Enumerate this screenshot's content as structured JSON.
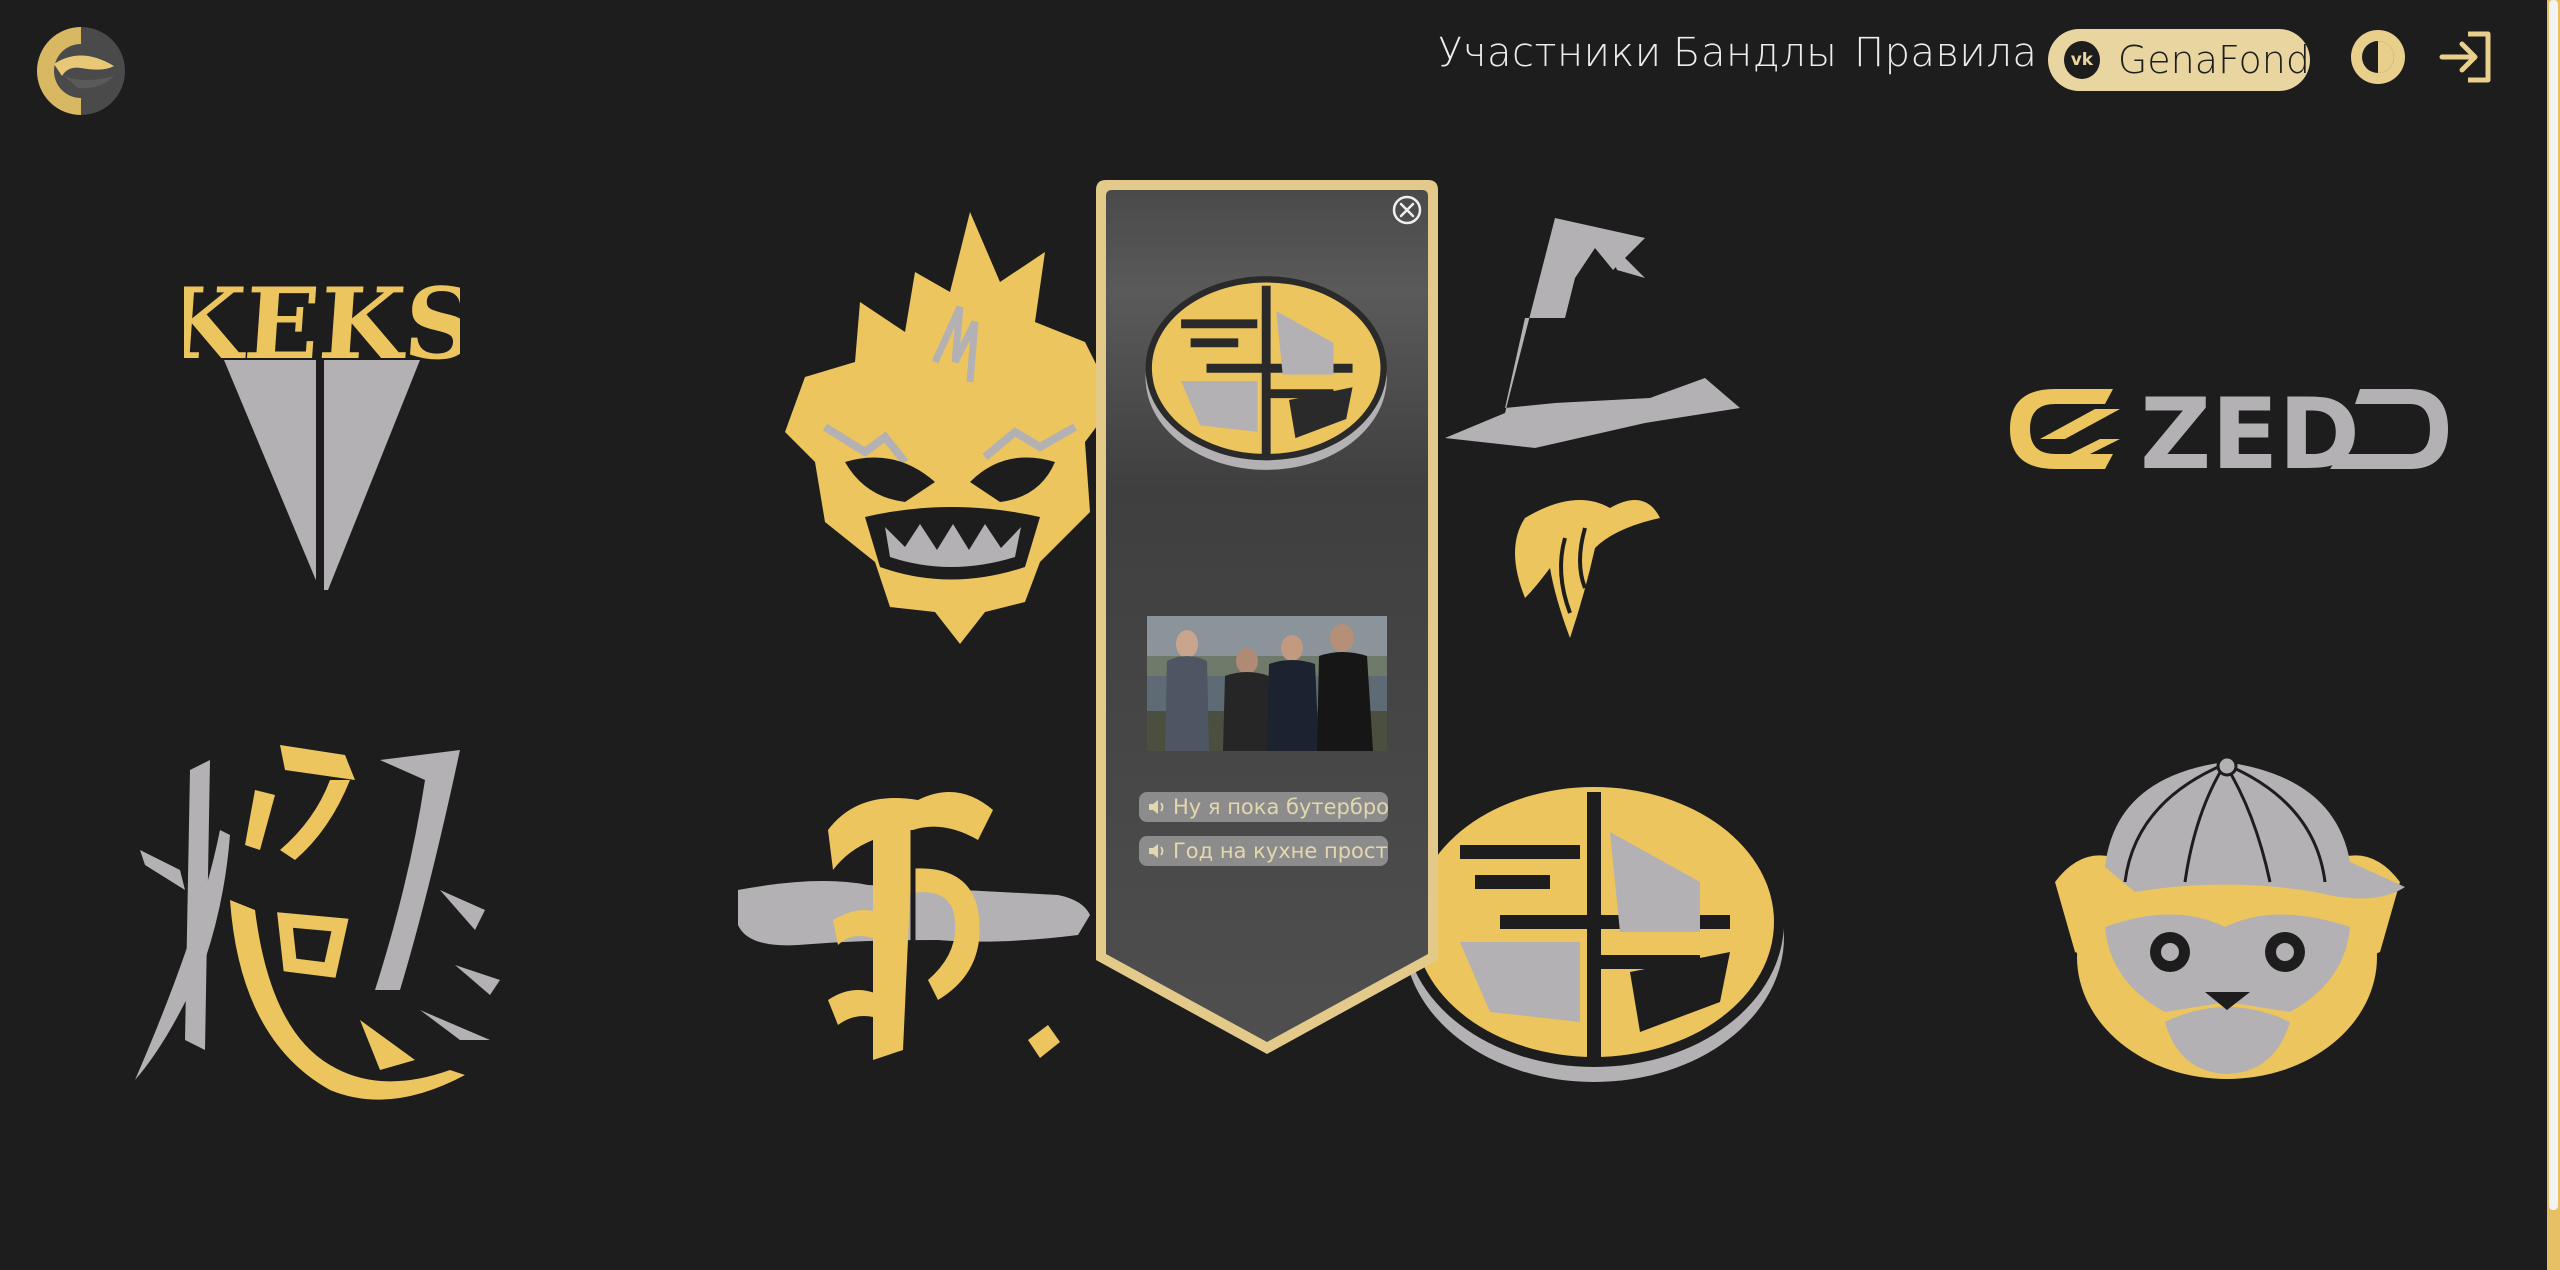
{
  "header": {
    "nav": {
      "participants": "Участники",
      "bands": "Бандлы",
      "rules": "Правила"
    },
    "vk_button": {
      "icon_text": "vk",
      "label": "GenaFond"
    },
    "icons": {
      "logo": "site-logo-icon",
      "theme_toggle": "theme-toggle-icon",
      "login": "login-icon"
    }
  },
  "logos": {
    "keks": {
      "text": "KEKS"
    },
    "ezed": {
      "text": "ZED"
    }
  },
  "modal": {
    "close_icon": "close-icon",
    "audio_clips": [
      {
        "label": "Ну я пока бутерброд..."
      },
      {
        "label": "Год на кухне просто..."
      }
    ]
  },
  "colors": {
    "background": "#1d1d1d",
    "gold": "#ecc55e",
    "silver": "#b3b1b3",
    "cream": "#e9d59f"
  }
}
